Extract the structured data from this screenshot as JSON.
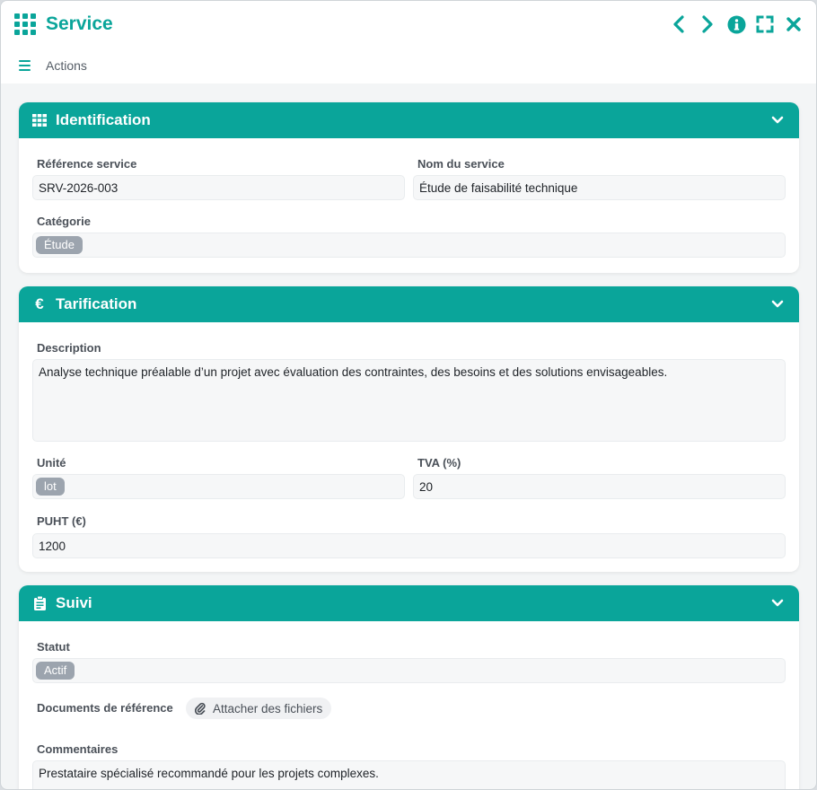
{
  "window": {
    "title": "Service"
  },
  "toolbar": {
    "actions_label": "Actions"
  },
  "sections": {
    "identification": {
      "title": "Identification",
      "reference_label": "Référence service",
      "reference_value": "SRV-2026-003",
      "name_label": "Nom du service",
      "name_value": "Étude de faisabilité technique",
      "category_label": "Catégorie",
      "category_tag": "Étude"
    },
    "tarification": {
      "title": "Tarification",
      "description_label": "Description",
      "description_value": "Analyse technique préalable d’un projet avec évaluation des contraintes, des besoins et des solutions envisageables.",
      "unit_label": "Unité",
      "unit_tag": "lot",
      "tva_label": "TVA (%)",
      "tva_value": "20",
      "puht_label": "PUHT (€)",
      "puht_value": "1200"
    },
    "suivi": {
      "title": "Suivi",
      "status_label": "Statut",
      "status_tag": "Actif",
      "docs_label": "Documents de référence",
      "attach_label": "Attacher des fichiers",
      "comments_label": "Commentaires",
      "comments_value": "Prestataire spécialisé recommandé pour les projets complexes."
    }
  },
  "colors": {
    "accent": "#0aa59a",
    "tag": "#9ca4ae",
    "field_bg": "#f6f7f8"
  },
  "icons": [
    "grid-icon",
    "prev-icon",
    "next-icon",
    "info-icon",
    "fullscreen-icon",
    "close-icon",
    "menu-icon",
    "table-icon",
    "euro-icon",
    "clipboard-icon",
    "chevron-down-icon",
    "paperclip-icon"
  ]
}
